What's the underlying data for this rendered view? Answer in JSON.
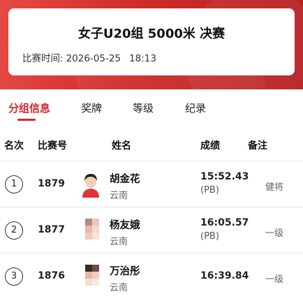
{
  "header": {
    "title": "女子U20组 5000米 决赛",
    "time_label": "比赛时间:",
    "date": "2026-05-25",
    "time": "18:13"
  },
  "tabs": [
    {
      "label": "分组信息",
      "active": true
    },
    {
      "label": "奖牌",
      "active": false
    },
    {
      "label": "等级",
      "active": false
    },
    {
      "label": "纪录",
      "active": false
    }
  ],
  "columns": {
    "rank": "名次",
    "bib": "比赛号",
    "name": "姓名",
    "result": "成绩",
    "note": "备注"
  },
  "rows": [
    {
      "rank": "1",
      "bib": "1879",
      "name": "胡金花",
      "region": "云南",
      "result": "15:52.43",
      "pb": "(PB)",
      "note": "健将"
    },
    {
      "rank": "2",
      "bib": "1877",
      "name": "杨友娥",
      "region": "云南",
      "result": "16:05.57",
      "pb": "(PB)",
      "note": "一级"
    },
    {
      "rank": "3",
      "bib": "1876",
      "name": "万治彤",
      "region": "云南",
      "result": "16:39.84",
      "pb": "",
      "note": "一级"
    }
  ],
  "colors": {
    "accent": "#d4282a",
    "header_red": "#cf2b2a"
  }
}
